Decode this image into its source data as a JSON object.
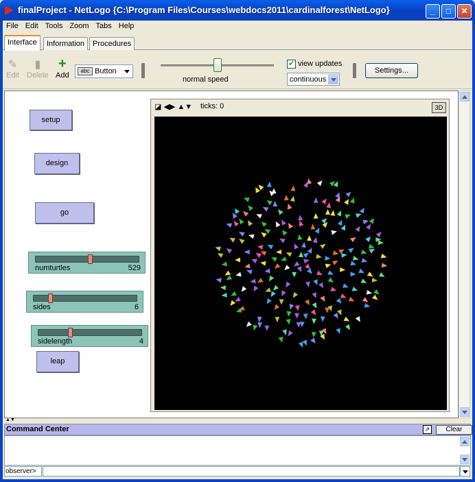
{
  "window": {
    "title": "finalProject - NetLogo {C:\\Program Files\\Courses\\webdocs2011\\cardinalforest\\NetLogo}"
  },
  "menu": [
    "File",
    "Edit",
    "Tools",
    "Zoom",
    "Tabs",
    "Help"
  ],
  "tabs": [
    "Interface",
    "Information",
    "Procedures"
  ],
  "toolbar": {
    "edit": "Edit",
    "delete": "Delete",
    "add": "Add",
    "widget_type": "Button",
    "speed_label": "normal speed",
    "speed_value": 0.5,
    "view_updates_label": "view updates",
    "view_updates_checked": true,
    "update_mode": "continuous",
    "settings": "Settings..."
  },
  "buttons": {
    "setup": "setup",
    "design": "design",
    "go": "go",
    "leap": "leap"
  },
  "sliders": [
    {
      "name": "numturtles",
      "value": "529",
      "fraction": 0.53
    },
    {
      "name": "sides",
      "value": "6",
      "fraction": 0.15
    },
    {
      "name": "sidelength",
      "value": "4",
      "fraction": 0.3
    }
  ],
  "view": {
    "ticks_label": "ticks: 0",
    "three_d": "3D"
  },
  "command_center": {
    "title": "Command Center",
    "clear": "Clear",
    "agent": "observer>",
    "input": ""
  },
  "colors": {
    "button_bg": "#c0c0ec",
    "slider_bg": "#8cc4b8",
    "view_bg": "#000000",
    "title_bar": "#0842c4"
  }
}
